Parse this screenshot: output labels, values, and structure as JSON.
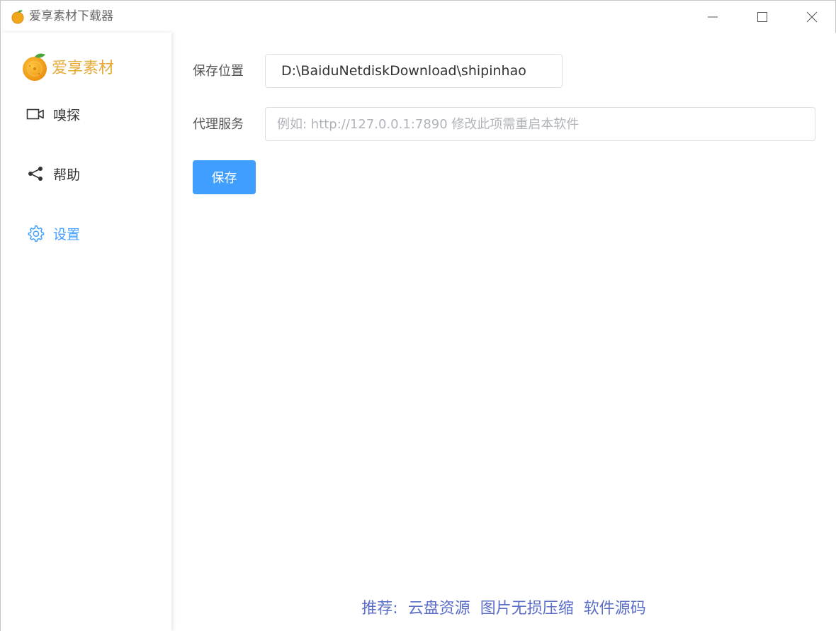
{
  "window": {
    "title": "爱享素材下载器"
  },
  "sidebar": {
    "brand": "爱享素材",
    "items": [
      {
        "label": "嗅探",
        "icon": "video-camera-icon"
      },
      {
        "label": "帮助",
        "icon": "share-icon"
      },
      {
        "label": "设置",
        "icon": "gear-icon",
        "active": true
      }
    ]
  },
  "form": {
    "save_location_label": "保存位置",
    "save_location_value": "D:\\BaiduNetdiskDownload\\shipinhao",
    "proxy_label": "代理服务",
    "proxy_placeholder": "例如: http://127.0.0.1:7890 修改此项需重启本软件",
    "proxy_value": "",
    "save_button": "保存"
  },
  "footer": {
    "prefix": "推荐:",
    "links": [
      "云盘资源",
      "图片无损压缩",
      "软件源码"
    ]
  },
  "colors": {
    "accent": "#409eff",
    "brand": "#e6a935",
    "footer_link": "#5b6ec7"
  }
}
